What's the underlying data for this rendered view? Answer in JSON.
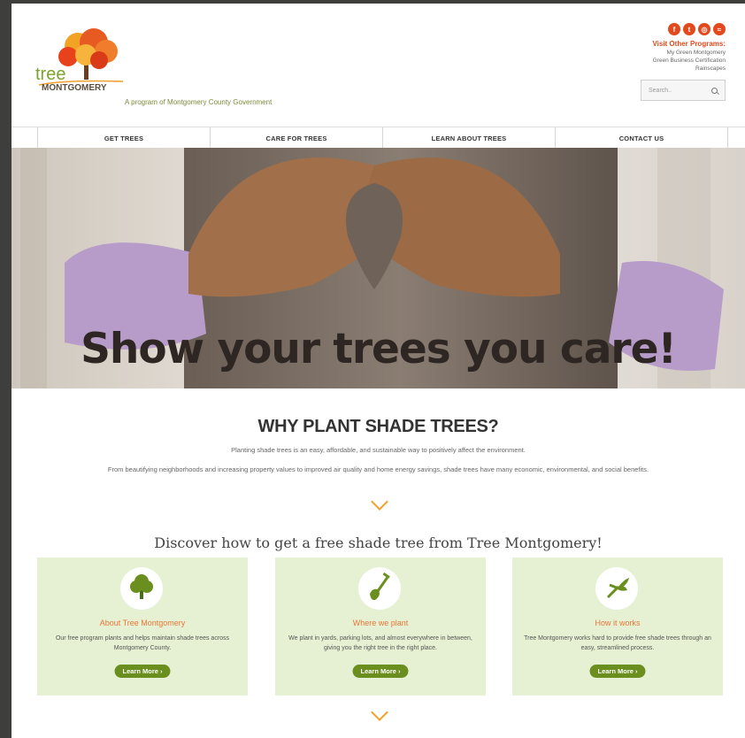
{
  "header": {
    "tagline": "A program of Montgomery County Government",
    "visit_title": "Visit Other Programs:",
    "other_programs": [
      "My Green Montgomery",
      "Green Business Certification",
      "Rainscapes"
    ],
    "search_placeholder": "Search.."
  },
  "social_icons": [
    "facebook-icon",
    "twitter-icon",
    "instagram-icon",
    "rss-icon"
  ],
  "nav": [
    "GET TREES",
    "CARE FOR TREES",
    "LEARN ABOUT TREES",
    "CONTACT US"
  ],
  "hero": {
    "text": "Show your trees you care!"
  },
  "why": {
    "title": "WHY PLANT SHADE TREES?",
    "p1": "Planting shade trees is an easy, affordable, and sustainable way to positively affect the environment.",
    "p2": "From beautifying neighborhoods and increasing property values to improved air quality and home energy savings, shade trees have many economic, environmental, and social benefits."
  },
  "discover": {
    "title": "Discover how to get a free shade tree from Tree Montgomery!"
  },
  "cards": [
    {
      "icon": "tree-icon",
      "title": "About Tree Montgomery",
      "text": "Our free program plants and helps maintain shade trees across Montgomery County.",
      "button": "Learn More ›"
    },
    {
      "icon": "shovel-icon",
      "title": "Where we plant",
      "text": "We plant in yards, parking lots, and almost everywhere in between, giving you the right tree in the right place.",
      "button": "Learn More ›"
    },
    {
      "icon": "pruning-shears-icon",
      "title": "How it works",
      "text": "Tree Montgomery works hard to provide free shade trees through an easy, streamlined process.",
      "button": "Learn More ›"
    }
  ],
  "colors": {
    "accent_orange": "#e2491d",
    "card_bg": "#e5f1d2",
    "button_green": "#6a8f1f",
    "chevron": "#f0a02a"
  }
}
